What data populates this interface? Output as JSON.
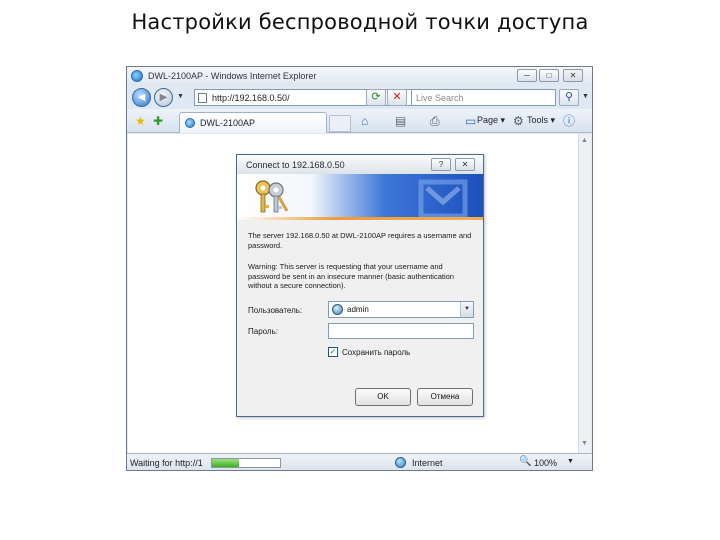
{
  "slide": {
    "title": "Настройки беспроводной точки доступа"
  },
  "window": {
    "title": "DWL-2100AP - Windows Internet Explorer",
    "minimize": "─",
    "maximize": "□",
    "close": "✕"
  },
  "navbar": {
    "address": "http://192.168.0.50/",
    "refresh_symbol": "⟳",
    "stop_symbol": "✕",
    "search_placeholder": "Live Search",
    "search_symbol": "⚲"
  },
  "toolbar": {
    "tab_label": "DWL-2100AP",
    "commands": {
      "page": "Page ▾",
      "tools": "Tools ▾"
    }
  },
  "status": {
    "text": "Waiting for http://1",
    "progress": 0.4,
    "zone": "Internet",
    "zoom": "100%"
  },
  "dialog": {
    "title": "Connect to 192.168.0.50",
    "help": "?",
    "close": "✕",
    "message1": "The server 192.168.0.50 at DWL-2100AP requires a username and password.",
    "message2": "Warning: This server is requesting that your username and password be sent in an insecure manner (basic authentication without a secure connection).",
    "username_label": "Пользователь:",
    "username_value": "admin",
    "password_label": "Пароль:",
    "password_value": "",
    "remember_label": "Сохранить пароль",
    "remember_checked": true,
    "ok_label": "OK",
    "cancel_label": "Отмена"
  },
  "colors": {
    "banner_blue": "#1d4fbd",
    "accent_orange": "#f09a3a",
    "progress_green": "#3fae1f"
  }
}
